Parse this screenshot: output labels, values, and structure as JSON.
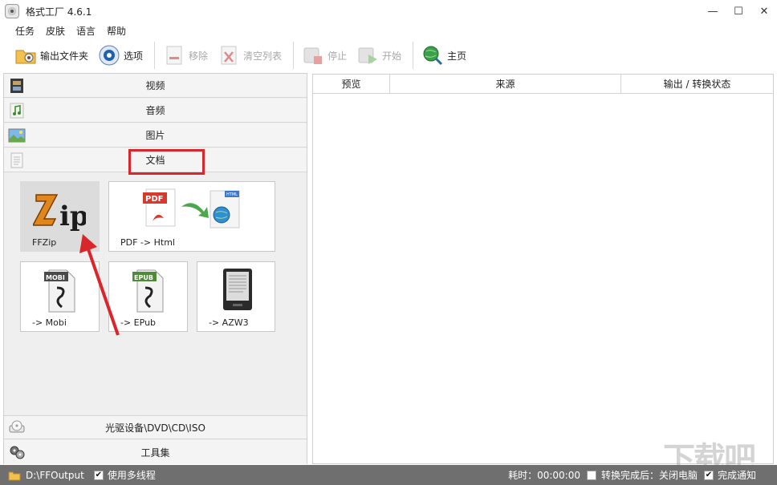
{
  "window": {
    "title": "格式工厂 4.6.1",
    "minimize": "—",
    "maximize": "☐",
    "close": "✕"
  },
  "menu": [
    "任务",
    "皮肤",
    "语言",
    "帮助"
  ],
  "toolbar": {
    "output_folder": "输出文件夹",
    "options": "选项",
    "remove": "移除",
    "clear_list": "清空列表",
    "stop": "停止",
    "start": "开始",
    "home": "主页"
  },
  "categories": {
    "video": "视频",
    "audio": "音频",
    "image": "图片",
    "document": "文档",
    "optical": "光驱设备\\DVD\\CD\\ISO",
    "tools": "工具集"
  },
  "tiles": {
    "ffzip": "FFZip",
    "pdf_html": "PDF -> Html",
    "mobi": "-> Mobi",
    "epub": "-> EPub",
    "azw3": "-> AZW3",
    "pdf_badge": "PDF",
    "html_badge": "HTML",
    "mobi_badge": "MOBI",
    "epub_badge": "EPUB"
  },
  "table": {
    "columns": [
      "预览",
      "来源",
      "输出 / 转换状态"
    ]
  },
  "status": {
    "output_path": "D:\\FFOutput",
    "multithread": "使用多线程",
    "elapsed": "耗时：00:00:00",
    "after_done": "转换完成后：关闭电脑",
    "notify": "完成通知"
  },
  "watermark": "下载吧",
  "colors": {
    "highlight": "#d9262b",
    "arrow": "#d9262b",
    "statusbar": "#6f6f6f"
  }
}
